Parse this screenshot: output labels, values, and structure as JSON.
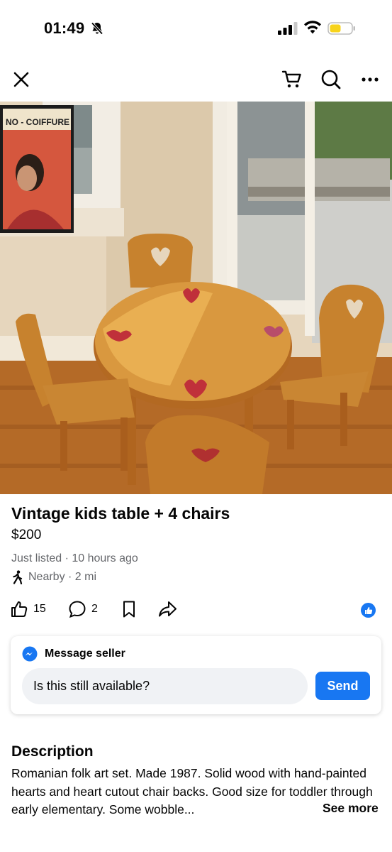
{
  "status_bar": {
    "time": "01:49",
    "battery_color": "#f7d31c"
  },
  "nav": {
    "close_icon": "close-icon",
    "cart_icon": "cart-icon",
    "search_icon": "search-icon",
    "more_icon": "more-icon"
  },
  "photo": {
    "sign_text": "NO - COIFFURE",
    "pager_count": 4,
    "pager_active": 1
  },
  "listing": {
    "title": "Vintage kids table + 4 chairs",
    "price": "$200",
    "listed": "Just listed · 10 hours ago",
    "nearby": "Nearby · 2 mi"
  },
  "actions": {
    "likes": "15",
    "comments": "2"
  },
  "message": {
    "header": "Message seller",
    "input_value": "Is this still available?",
    "send_label": "Send"
  },
  "description": {
    "title": "Description",
    "text": "Romanian folk art set. Made 1987. Solid wood with hand-painted hearts and heart cutout chair backs. Good size for toddler through early elementary. Some wobble...",
    "see_more": "See more"
  },
  "colors": {
    "accent": "#1877f2",
    "secondary_text": "#65676b",
    "input_bg": "#f0f2f5"
  }
}
